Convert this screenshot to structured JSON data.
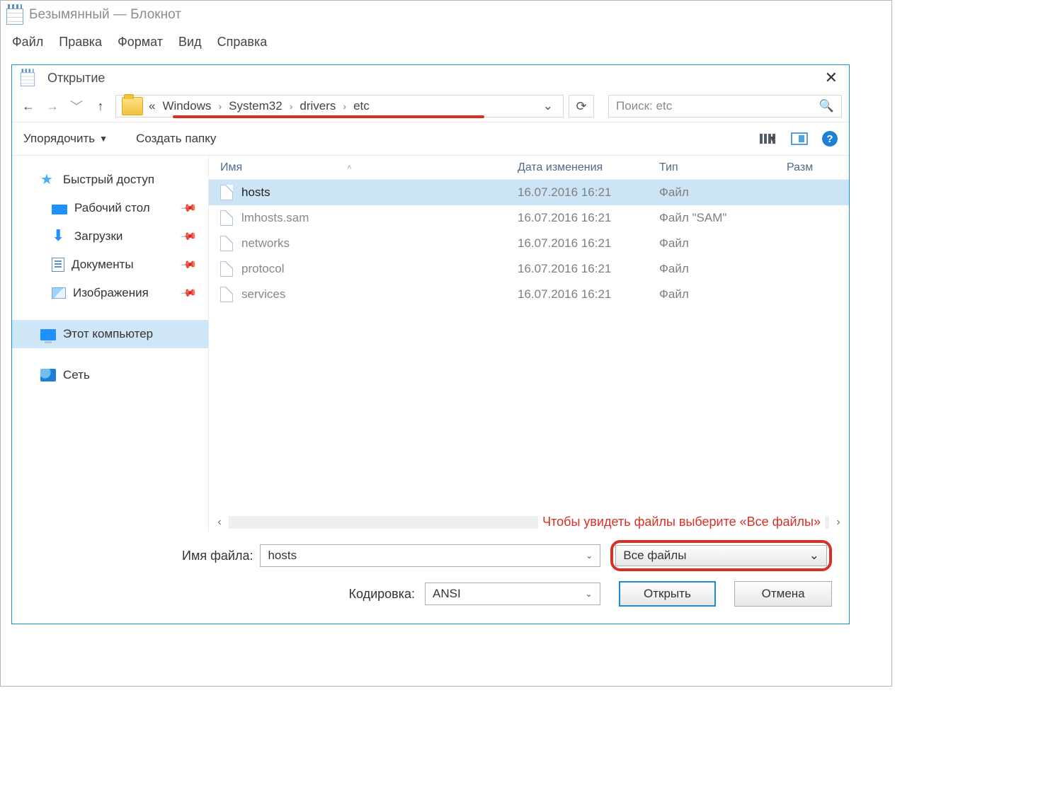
{
  "notepad": {
    "title": "Безымянный — Блокнот",
    "menu": {
      "file": "Файл",
      "edit": "Правка",
      "format": "Формат",
      "view": "Вид",
      "help": "Справка"
    }
  },
  "dialog": {
    "title": "Открытие",
    "breadcrumb": {
      "prefix": "«",
      "parts": [
        "Windows",
        "System32",
        "drivers",
        "etc"
      ]
    },
    "search_placeholder": "Поиск: etc",
    "toolbar": {
      "organize": "Упорядочить",
      "new_folder": "Создать папку"
    },
    "sidebar": {
      "quick": "Быстрый доступ",
      "desktop": "Рабочий стол",
      "downloads": "Загрузки",
      "documents": "Документы",
      "pictures": "Изображения",
      "this_pc": "Этот компьютер",
      "network": "Сеть"
    },
    "columns": {
      "name": "Имя",
      "date": "Дата изменения",
      "type": "Тип",
      "size": "Разм"
    },
    "files": [
      {
        "name": "hosts",
        "date": "16.07.2016 16:21",
        "type": "Файл",
        "selected": true
      },
      {
        "name": "lmhosts.sam",
        "date": "16.07.2016 16:21",
        "type": "Файл \"SAM\"",
        "selected": false
      },
      {
        "name": "networks",
        "date": "16.07.2016 16:21",
        "type": "Файл",
        "selected": false
      },
      {
        "name": "protocol",
        "date": "16.07.2016 16:21",
        "type": "Файл",
        "selected": false
      },
      {
        "name": "services",
        "date": "16.07.2016 16:21",
        "type": "Файл",
        "selected": false
      }
    ],
    "annotation": "Чтобы увидеть файлы выберите «Все файлы»",
    "footer": {
      "filename_label": "Имя файла:",
      "filename_value": "hosts",
      "filetype_value": "Все файлы",
      "encoding_label": "Кодировка:",
      "encoding_value": "ANSI",
      "open": "Открыть",
      "cancel": "Отмена"
    }
  }
}
